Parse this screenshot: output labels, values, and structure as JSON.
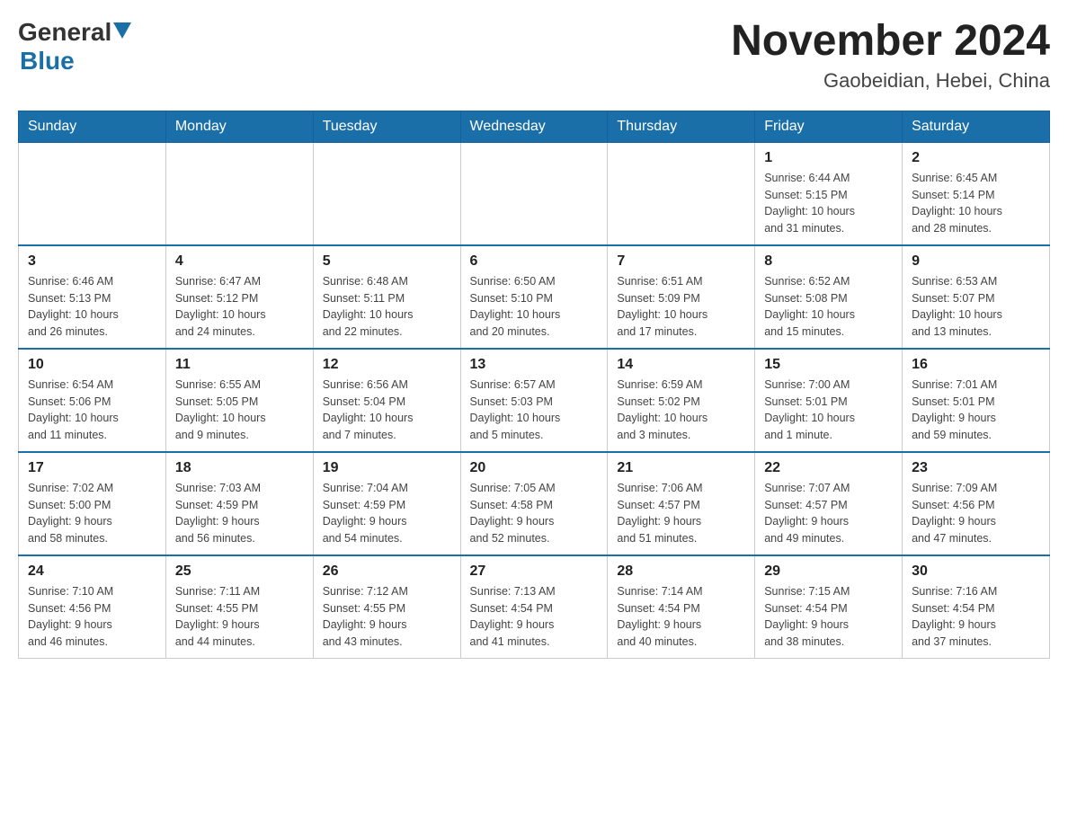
{
  "header": {
    "logo_general": "General",
    "logo_blue": "Blue",
    "month_title": "November 2024",
    "location": "Gaobeidian, Hebei, China"
  },
  "weekdays": [
    "Sunday",
    "Monday",
    "Tuesday",
    "Wednesday",
    "Thursday",
    "Friday",
    "Saturday"
  ],
  "weeks": [
    [
      {
        "day": "",
        "info": ""
      },
      {
        "day": "",
        "info": ""
      },
      {
        "day": "",
        "info": ""
      },
      {
        "day": "",
        "info": ""
      },
      {
        "day": "",
        "info": ""
      },
      {
        "day": "1",
        "info": "Sunrise: 6:44 AM\nSunset: 5:15 PM\nDaylight: 10 hours\nand 31 minutes."
      },
      {
        "day": "2",
        "info": "Sunrise: 6:45 AM\nSunset: 5:14 PM\nDaylight: 10 hours\nand 28 minutes."
      }
    ],
    [
      {
        "day": "3",
        "info": "Sunrise: 6:46 AM\nSunset: 5:13 PM\nDaylight: 10 hours\nand 26 minutes."
      },
      {
        "day": "4",
        "info": "Sunrise: 6:47 AM\nSunset: 5:12 PM\nDaylight: 10 hours\nand 24 minutes."
      },
      {
        "day": "5",
        "info": "Sunrise: 6:48 AM\nSunset: 5:11 PM\nDaylight: 10 hours\nand 22 minutes."
      },
      {
        "day": "6",
        "info": "Sunrise: 6:50 AM\nSunset: 5:10 PM\nDaylight: 10 hours\nand 20 minutes."
      },
      {
        "day": "7",
        "info": "Sunrise: 6:51 AM\nSunset: 5:09 PM\nDaylight: 10 hours\nand 17 minutes."
      },
      {
        "day": "8",
        "info": "Sunrise: 6:52 AM\nSunset: 5:08 PM\nDaylight: 10 hours\nand 15 minutes."
      },
      {
        "day": "9",
        "info": "Sunrise: 6:53 AM\nSunset: 5:07 PM\nDaylight: 10 hours\nand 13 minutes."
      }
    ],
    [
      {
        "day": "10",
        "info": "Sunrise: 6:54 AM\nSunset: 5:06 PM\nDaylight: 10 hours\nand 11 minutes."
      },
      {
        "day": "11",
        "info": "Sunrise: 6:55 AM\nSunset: 5:05 PM\nDaylight: 10 hours\nand 9 minutes."
      },
      {
        "day": "12",
        "info": "Sunrise: 6:56 AM\nSunset: 5:04 PM\nDaylight: 10 hours\nand 7 minutes."
      },
      {
        "day": "13",
        "info": "Sunrise: 6:57 AM\nSunset: 5:03 PM\nDaylight: 10 hours\nand 5 minutes."
      },
      {
        "day": "14",
        "info": "Sunrise: 6:59 AM\nSunset: 5:02 PM\nDaylight: 10 hours\nand 3 minutes."
      },
      {
        "day": "15",
        "info": "Sunrise: 7:00 AM\nSunset: 5:01 PM\nDaylight: 10 hours\nand 1 minute."
      },
      {
        "day": "16",
        "info": "Sunrise: 7:01 AM\nSunset: 5:01 PM\nDaylight: 9 hours\nand 59 minutes."
      }
    ],
    [
      {
        "day": "17",
        "info": "Sunrise: 7:02 AM\nSunset: 5:00 PM\nDaylight: 9 hours\nand 58 minutes."
      },
      {
        "day": "18",
        "info": "Sunrise: 7:03 AM\nSunset: 4:59 PM\nDaylight: 9 hours\nand 56 minutes."
      },
      {
        "day": "19",
        "info": "Sunrise: 7:04 AM\nSunset: 4:59 PM\nDaylight: 9 hours\nand 54 minutes."
      },
      {
        "day": "20",
        "info": "Sunrise: 7:05 AM\nSunset: 4:58 PM\nDaylight: 9 hours\nand 52 minutes."
      },
      {
        "day": "21",
        "info": "Sunrise: 7:06 AM\nSunset: 4:57 PM\nDaylight: 9 hours\nand 51 minutes."
      },
      {
        "day": "22",
        "info": "Sunrise: 7:07 AM\nSunset: 4:57 PM\nDaylight: 9 hours\nand 49 minutes."
      },
      {
        "day": "23",
        "info": "Sunrise: 7:09 AM\nSunset: 4:56 PM\nDaylight: 9 hours\nand 47 minutes."
      }
    ],
    [
      {
        "day": "24",
        "info": "Sunrise: 7:10 AM\nSunset: 4:56 PM\nDaylight: 9 hours\nand 46 minutes."
      },
      {
        "day": "25",
        "info": "Sunrise: 7:11 AM\nSunset: 4:55 PM\nDaylight: 9 hours\nand 44 minutes."
      },
      {
        "day": "26",
        "info": "Sunrise: 7:12 AM\nSunset: 4:55 PM\nDaylight: 9 hours\nand 43 minutes."
      },
      {
        "day": "27",
        "info": "Sunrise: 7:13 AM\nSunset: 4:54 PM\nDaylight: 9 hours\nand 41 minutes."
      },
      {
        "day": "28",
        "info": "Sunrise: 7:14 AM\nSunset: 4:54 PM\nDaylight: 9 hours\nand 40 minutes."
      },
      {
        "day": "29",
        "info": "Sunrise: 7:15 AM\nSunset: 4:54 PM\nDaylight: 9 hours\nand 38 minutes."
      },
      {
        "day": "30",
        "info": "Sunrise: 7:16 AM\nSunset: 4:54 PM\nDaylight: 9 hours\nand 37 minutes."
      }
    ]
  ]
}
